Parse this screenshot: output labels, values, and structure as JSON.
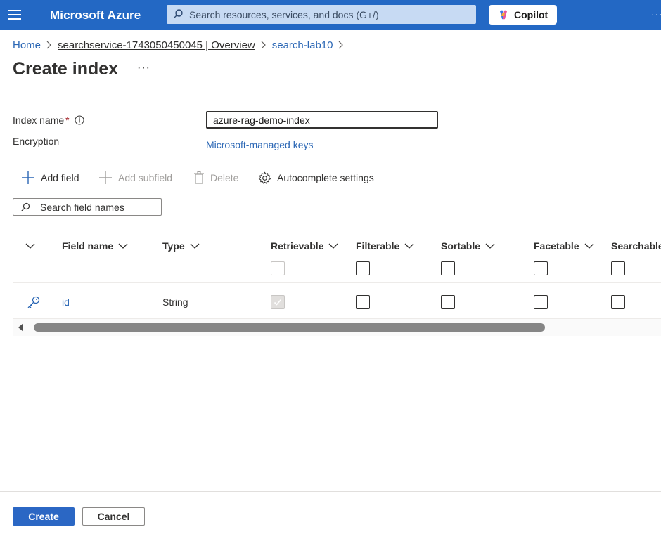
{
  "topbar": {
    "brand": "Microsoft Azure",
    "search_placeholder": "Search resources, services, and docs (G+/)",
    "copilot_label": "Copilot",
    "more": "···"
  },
  "breadcrumb": {
    "items": [
      "Home",
      "searchservice-1743050450045 | Overview",
      "search-lab10"
    ]
  },
  "page": {
    "title": "Create index",
    "more": "···"
  },
  "form": {
    "index_name_label": "Index name",
    "required_mark": "*",
    "index_name_value": "azure-rag-demo-index",
    "encryption_label": "Encryption",
    "encryption_link": "Microsoft-managed keys"
  },
  "toolbar": {
    "add_field": "Add field",
    "add_subfield": "Add subfield",
    "delete": "Delete",
    "autocomplete": "Autocomplete settings"
  },
  "field_search": {
    "placeholder": "Search field names"
  },
  "grid": {
    "columns": [
      "Field name",
      "Type",
      "Retrievable",
      "Filterable",
      "Sortable",
      "Facetable",
      "Searchable"
    ],
    "rows": [
      {
        "field_name": "id",
        "type": "String",
        "key": true,
        "retrievable": true,
        "filterable": false,
        "sortable": false,
        "facetable": false,
        "searchable": false
      }
    ]
  },
  "footer": {
    "create": "Create",
    "cancel": "Cancel"
  },
  "colors": {
    "topbar": "#2368c4",
    "link": "#2b67b5",
    "primary": "#2b67c4"
  }
}
